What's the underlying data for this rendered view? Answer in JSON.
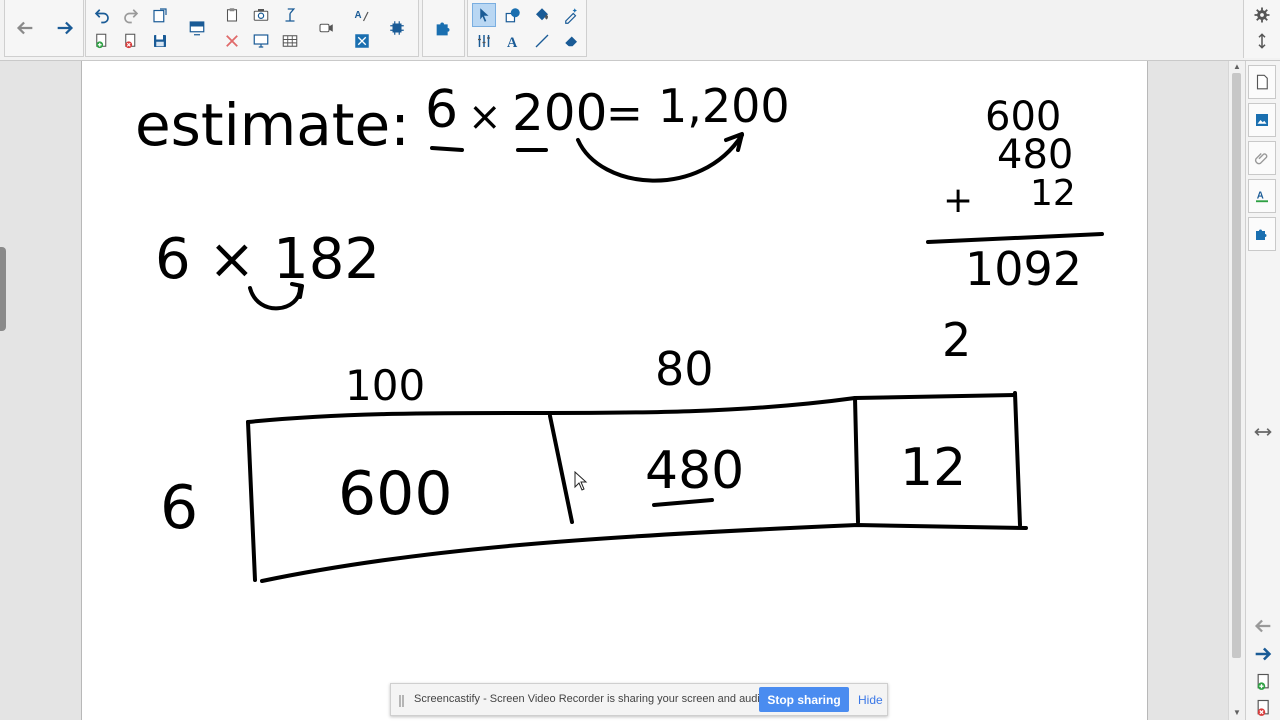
{
  "whiteboard": {
    "estimate_label": "estimate:",
    "estimate_factor": "6",
    "estimate_x": "×",
    "estimate_rounded": "200",
    "estimate_eq": "=",
    "estimate_result": "1,200",
    "problem": "6 × 182",
    "row_label": "6",
    "col_1": "100",
    "col_2": "80",
    "col_3": "2",
    "cell_1": "600",
    "cell_2": "480",
    "cell_3": "12",
    "sum_1": "600",
    "sum_2": "480",
    "sum_plus": "+",
    "sum_3": "12",
    "sum_total": "1092"
  },
  "notification": {
    "message": "Screencastify - Screen Video Recorder is sharing your screen and audio.",
    "stop_label": "Stop sharing",
    "hide_label": "Hide"
  },
  "icons": {
    "toolbar": [
      "back-arrow-icon",
      "forward-arrow-icon",
      "undo-icon",
      "redo-icon",
      "paste-icon",
      "add-page-icon",
      "delete-page-icon",
      "save-icon",
      "screen-shade-icon",
      "clear-icon",
      "screen-capture-icon",
      "show-display-icon",
      "document-camera-icon",
      "table-icon",
      "record-icon",
      "text-recognition-icon",
      "addons-icon",
      "puzzle-icon",
      "select-icon",
      "shapes-icon",
      "fill-icon",
      "magic-pen-icon",
      "measurement-icon",
      "text-icon",
      "line-icon",
      "eraser-icon",
      "settings-icon",
      "move-toolbar-icon"
    ],
    "sidepanel": [
      "page-sorter-icon",
      "gallery-icon",
      "attachments-icon",
      "properties-icon",
      "addons-icon",
      "resize-panel-icon",
      "previous-page-icon",
      "next-page-icon",
      "add-page-icon",
      "delete-page-icon"
    ]
  },
  "colors": {
    "accent": "#1a6fb0",
    "ink": "#000000",
    "stop_button": "#4a8cf0",
    "toolbar_bg": "#f2f2f2"
  }
}
